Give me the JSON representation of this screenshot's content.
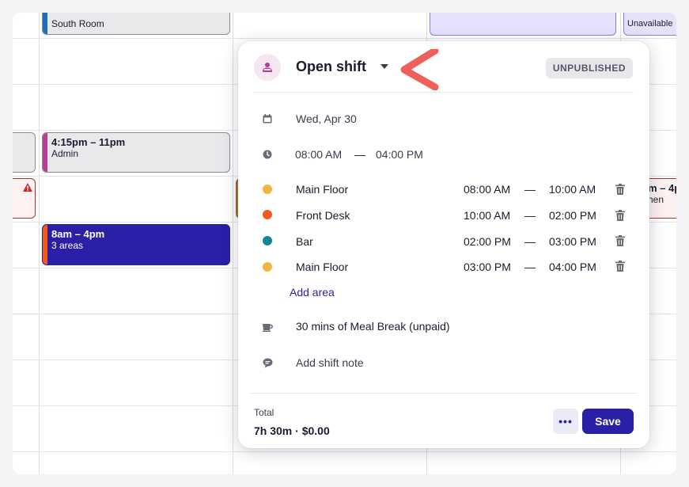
{
  "background_shifts": {
    "south_room": "South Room",
    "admin_time": "4:15pm – 11pm",
    "admin_role": "Admin",
    "areas_time": "8am – 4pm",
    "areas_count": "3 areas",
    "unavailable": "Unavailable",
    "right_partial_time": "m – 4p",
    "right_partial_sub": "hen"
  },
  "popover": {
    "title": "Open shift",
    "status_badge": "UNPUBLISHED",
    "date": "Wed, Apr 30",
    "start_time": "08:00 AM",
    "time_separator": "—",
    "end_time": "04:00 PM",
    "areas": [
      {
        "name": "Main Floor",
        "start": "08:00 AM",
        "end": "10:00 AM",
        "color": "#f5b342"
      },
      {
        "name": "Front Desk",
        "start": "10:00 AM",
        "end": "02:00 PM",
        "color": "#f05a1e"
      },
      {
        "name": "Bar",
        "start": "02:00 PM",
        "end": "03:00 PM",
        "color": "#0e8a8f"
      },
      {
        "name": "Main Floor",
        "start": "03:00 PM",
        "end": "04:00 PM",
        "color": "#f5b342"
      }
    ],
    "add_area_label": "Add area",
    "break_label": "30 mins of Meal Break (unpaid)",
    "note_placeholder": "Add shift note",
    "total_label": "Total",
    "total_value": "7h 30m · $0.00",
    "more_label": "•••",
    "save_label": "Save"
  },
  "colors": {
    "accent": "#2a20a6",
    "annotation_arrow": "#f0605a"
  }
}
